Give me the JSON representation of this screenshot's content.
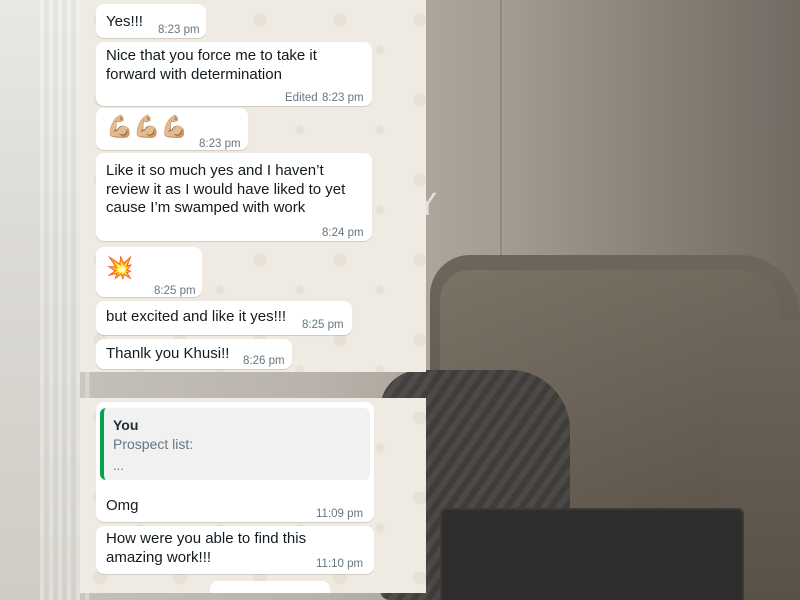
{
  "background": {
    "ghost_letter": "Y"
  },
  "chat_top": {
    "messages": [
      {
        "text": "Yes!!!",
        "time": "8:23 pm"
      },
      {
        "text": "Nice that you force me to take it\nforward with determination",
        "time": "8:23 pm",
        "edited": "Edited"
      },
      {
        "text": "💪🏼💪🏼💪🏼",
        "time": "8:23 pm"
      },
      {
        "text": "Like it so much yes and I haven’t\nreview it as I would have liked to yet\ncause I’m swamped with work",
        "time": "8:24 pm"
      },
      {
        "text": "💥",
        "time": "8:25 pm"
      },
      {
        "text": "but excited and like it yes!!!",
        "time": "8:25 pm"
      },
      {
        "text": "Thanlk you Khusi!!",
        "time": "8:26 pm"
      }
    ]
  },
  "chat_bottom": {
    "reply_quote": {
      "author": "You",
      "text": "Prospect list:",
      "more": "..."
    },
    "messages": [
      {
        "text": "Omg",
        "time": "11:09 pm"
      },
      {
        "text": "How were you able to find this\namazing work!!!",
        "time": "11:10 pm"
      }
    ]
  },
  "colors": {
    "chat_background": "#efeae2",
    "bubble": "#ffffff",
    "quote_accent": "#06a34f",
    "timestamp": "#667781"
  }
}
